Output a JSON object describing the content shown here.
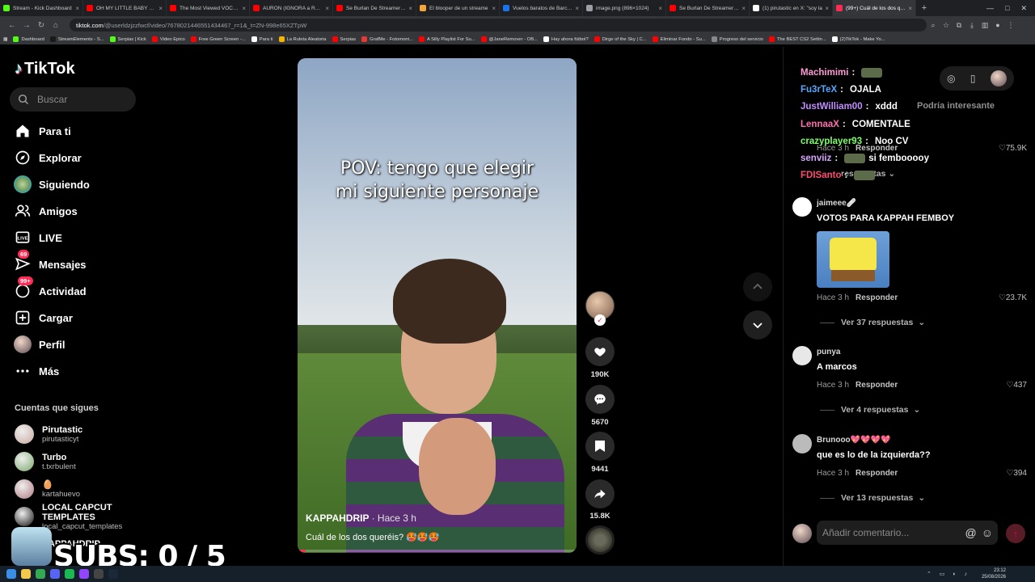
{
  "browser": {
    "tabs": [
      {
        "title": "Stream - Kick Dashboard",
        "color": "#53fc18"
      },
      {
        "title": "OH MY LITTLE BABY BOY",
        "color": "#ff0000"
      },
      {
        "title": "The Most Viewed VOCALO",
        "color": "#ff0000"
      },
      {
        "title": "AURON (IGNORA a REBO",
        "color": "#ff0000"
      },
      {
        "title": "Se Burlan De Streamer Pa",
        "color": "#ff0000"
      },
      {
        "title": "El blooper de un streame",
        "color": "#f2a33a"
      },
      {
        "title": "Vuelos baratos de Barcelo",
        "color": "#1a73e8"
      },
      {
        "title": "image.png (896×1024)",
        "color": "#9aa0a6"
      },
      {
        "title": "Se Burlan De Streamer Pa",
        "color": "#ff0000"
      },
      {
        "title": "(1) pirutastic en X: \"soy la",
        "color": "#ffffff"
      },
      {
        "title": "(99+) Cuál de los dos que",
        "color": "#fe2c55",
        "active": true
      }
    ],
    "new_tab": "+",
    "url_host": "tiktok.com",
    "url_rest": "/@userldzjzzfwcf/video/7678021446551434467_r=1&_t=ZN-998e65XZTpW",
    "bookmarks": [
      {
        "label": "Dashboard",
        "color": "#53fc18"
      },
      {
        "label": "StreamElements - S...",
        "color": "#1a1a1a"
      },
      {
        "label": "Serpias | Kick",
        "color": "#53fc18"
      },
      {
        "label": "Video Epico",
        "color": "#ff0000"
      },
      {
        "label": "Free Green Screen -...",
        "color": "#ff0000"
      },
      {
        "label": "Para ti",
        "color": "#ffffff"
      },
      {
        "label": "La Ruleta Aleatoria",
        "color": "#f4b400"
      },
      {
        "label": "Serpias",
        "color": "#ff0000"
      },
      {
        "label": "GrafMe - Fotomont...",
        "color": "#e53935"
      },
      {
        "label": "A Silly Playlist For Su...",
        "color": "#ff0000"
      },
      {
        "label": "@JaneRemover - OB...",
        "color": "#ff0000"
      },
      {
        "label": "Hay ahora fútbol?",
        "color": "#ffffff"
      },
      {
        "label": "Dirge of the Sky | C...",
        "color": "#ff0000"
      },
      {
        "label": "Eliminar Fondo - Su...",
        "color": "#ff0000"
      },
      {
        "label": "Progreso del servicio",
        "color": "#888888"
      },
      {
        "label": "The BEST CS2 Settin...",
        "color": "#ff0000"
      },
      {
        "label": "(2)TikTok - Make Yo...",
        "color": "#ffffff"
      }
    ]
  },
  "sidebar": {
    "logo": "TikTok",
    "search_placeholder": "Buscar",
    "nav": [
      {
        "label": "Para ti",
        "icon": "home-icon"
      },
      {
        "label": "Explorar",
        "icon": "compass-icon"
      },
      {
        "label": "Siguiendo",
        "icon": "following-avatar"
      },
      {
        "label": "Amigos",
        "icon": "friends-icon"
      },
      {
        "label": "LIVE",
        "icon": "live-icon"
      },
      {
        "label": "Mensajes",
        "icon": "messages-icon",
        "badge": "69"
      },
      {
        "label": "Actividad",
        "icon": "activity-icon",
        "badge": "99+"
      },
      {
        "label": "Cargar",
        "icon": "upload-icon"
      },
      {
        "label": "Perfil",
        "icon": "profile-avatar"
      },
      {
        "label": "Más",
        "icon": "more-icon"
      }
    ],
    "following_title": "Cuentas que sigues",
    "following": [
      {
        "name": "Pirutastic",
        "handle": "pirutasticyt",
        "color": "#c9a9a0"
      },
      {
        "name": "Turbo",
        "handle": "t.txrbulent",
        "color": "#7aa86a"
      },
      {
        "name": "🥚",
        "handle": "kartahuevo",
        "color": "#b07a80"
      },
      {
        "name": "LOCAL CAPCUT TEMPLATES",
        "handle": "local_capcut_templates",
        "color": "#111111"
      },
      {
        "name": "KAPPAHDRIP",
        "handle": "",
        "color": "#8a6b5a"
      }
    ]
  },
  "video": {
    "overlay_text_line1": "POV: tengo que elegir",
    "overlay_text_line2": "mi siguiente personaje",
    "author": "KAPPAHDRIP",
    "posted": "· Hace 3 h",
    "description": "Cuál de los dos queréis? 🥵🥵🥵",
    "progress": 0.03
  },
  "actions": {
    "likes": "190K",
    "comments": "5670",
    "saves": "9441",
    "shares": "15.8K"
  },
  "comments_panel": {
    "may_interest": "Podría interesante",
    "comments": [
      {
        "user": "jaimeee🩹",
        "text": "VOTOS PARA KAPPAH FEMBOY",
        "time": "Hace 3 h",
        "reply": "Responder",
        "likes": "23.7K",
        "replies": "Ver 37 respuestas",
        "avatar_color": "#ffffff"
      },
      {
        "user": "punya",
        "text": "A marcos",
        "time": "Hace 3 h",
        "reply": "Responder",
        "likes": "437",
        "replies": "Ver 4 respuestas",
        "avatar_color": "#e8e8e8"
      },
      {
        "user": "Brunooo💖💖💖💖",
        "text": "que es lo de la izquierda??",
        "time": "Hace 3 h",
        "reply": "Responder",
        "likes": "394",
        "replies": "Ver 13 respuestas",
        "avatar_color": "#bbbbbb"
      }
    ],
    "partial_comment": {
      "time": "Hace 3 h",
      "reply": "Responder",
      "likes": "75.9K",
      "replies": "respuestas"
    },
    "input_placeholder": "Añadir comentario..."
  },
  "chat_overlay": [
    {
      "user": "Machimimi",
      "sep": ":",
      "msg": "",
      "color": "#ff9ad5",
      "emote": true
    },
    {
      "user": "Fu3rTeX",
      "sep": ":",
      "msg": "OJALA",
      "color": "#55a8ff",
      "emote": false
    },
    {
      "user": "JustWilliam00",
      "sep": ":",
      "msg": "xddd",
      "color": "#c28dff",
      "emote": false
    },
    {
      "user": "LennaaX",
      "sep": ":",
      "msg": "COMENTALE",
      "color": "#ff6fb0",
      "emote": false
    },
    {
      "user": "crazyplayer93",
      "sep": ":",
      "msg": "Noo CV",
      "color": "#7dff6a",
      "emote": false
    },
    {
      "user": "senviiz",
      "sep": ":",
      "msg": "si fembooooy",
      "color": "#d9a6ff",
      "emote": true
    },
    {
      "user": "FDISanto",
      "sep": ":",
      "msg": "",
      "color": "#ff4b6e",
      "emote": true
    }
  ],
  "stream_overlay": {
    "subs_text": "SUBS: 0 / 5"
  },
  "taskbar": {
    "time": "23:12",
    "date": "25/08/2026"
  }
}
